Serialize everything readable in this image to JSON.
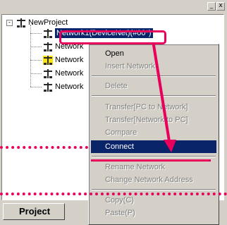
{
  "window": {
    "minimize_glyph": "_",
    "close_glyph": "x"
  },
  "tree": {
    "root_label": "NewProject",
    "root_expander": "-",
    "items": [
      {
        "label": "Network1(DeviceNet)(#00*)"
      },
      {
        "label": "Network"
      },
      {
        "label": "Network"
      },
      {
        "label": "Network"
      },
      {
        "label": "Network"
      }
    ]
  },
  "context_menu": {
    "items": [
      {
        "label": "Open",
        "state": "enabled"
      },
      {
        "label": "Insert Network",
        "state": "disabled"
      },
      {
        "label": "Delete",
        "state": "disabled"
      },
      {
        "label": "Transfer[PC to Network]",
        "state": "disabled"
      },
      {
        "label": "Transfer[Network to PC]",
        "state": "disabled"
      },
      {
        "label": "Compare",
        "state": "disabled"
      },
      {
        "label": "Connect",
        "state": "highlighted"
      },
      {
        "label": "Rename Network",
        "state": "disabled"
      },
      {
        "label": "Change Network Address",
        "state": "disabled"
      },
      {
        "label": "Copy(C)",
        "state": "disabled"
      },
      {
        "label": "Paste(P)",
        "state": "disabled"
      }
    ]
  },
  "tabs": {
    "project_label": "Project"
  },
  "colors": {
    "annotation": "#e8005a",
    "selection": "#0a246a",
    "panel": "#d4d0c8"
  }
}
